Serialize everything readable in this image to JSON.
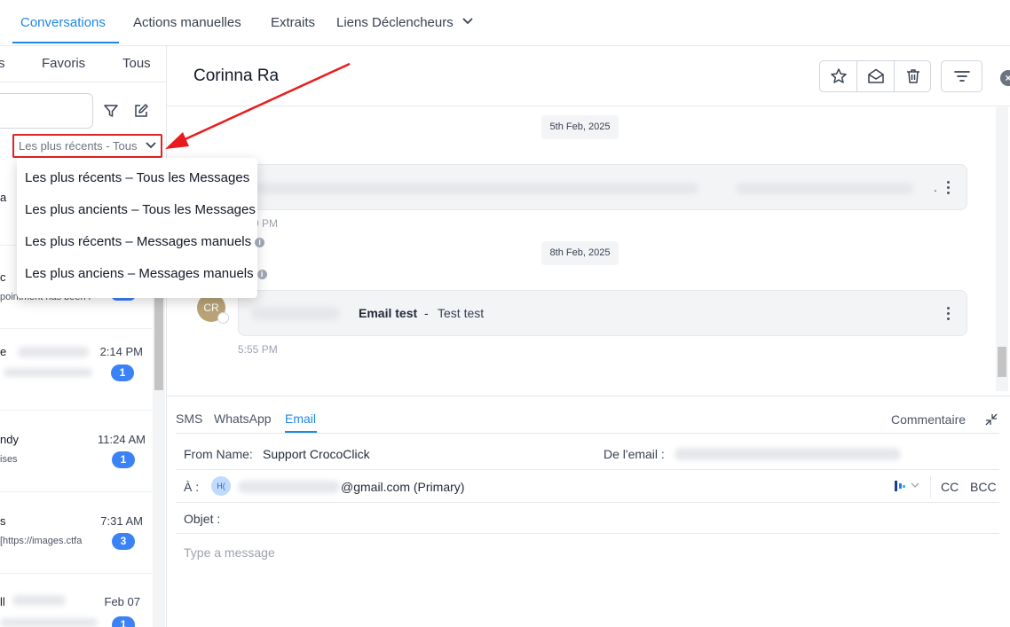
{
  "topnav": {
    "tabs": [
      "Conversations",
      "Actions manuelles",
      "Extraits",
      "Liens Déclencheurs"
    ],
    "active": "Conversations"
  },
  "left": {
    "subtabs": [
      "s",
      "Favoris",
      "Tous"
    ],
    "sort_label": "Les plus récents - Tous",
    "conversations": [
      {
        "name": "a",
        "time": "",
        "preview": "",
        "badge": ""
      },
      {
        "name": "c",
        "time": "",
        "preview": "pointment has been r",
        "badge": ""
      },
      {
        "name": "e",
        "time": "2:14 PM",
        "preview": "",
        "badge": "1"
      },
      {
        "name": "ndy",
        "time": "11:24 AM",
        "preview": "ises",
        "badge": "1"
      },
      {
        "name": "s",
        "time": "7:31 AM",
        "preview": "[https://images.ctfa",
        "badge": "3"
      },
      {
        "name": "ll",
        "time": "Feb 07",
        "preview": "",
        "badge": "1"
      }
    ]
  },
  "dropdown": {
    "items": [
      {
        "label": "Les plus récents – Tous les Messages",
        "info": false
      },
      {
        "label": "Les plus ancients – Tous les Messages",
        "info": false
      },
      {
        "label": "Les plus récents – Messages manuels",
        "info": true
      },
      {
        "label": "Les plus anciens – Messages manuels",
        "info": true
      }
    ]
  },
  "header": {
    "contact_name": "Corinna Ra",
    "close_glyph": "×"
  },
  "thread": {
    "messages": [
      {
        "date": "5th Feb, 2025",
        "time": "9 PM",
        "text_end": "."
      },
      {
        "date": "8th Feb, 2025",
        "time": "5:55 PM",
        "subject": "Email test",
        "separator": "-",
        "body": "Test test",
        "avatar": "CR"
      }
    ]
  },
  "composer": {
    "tabs": [
      "SMS",
      "WhatsApp",
      "Email"
    ],
    "active_tab": "Email",
    "comment_label": "Commentaire",
    "from_name_label": "From Name:",
    "from_name_value": "Support CrocoClick",
    "from_email_label": "De l'email :",
    "to_label": "À :",
    "to_avatar": "H(",
    "to_value": "@gmail.com (Primary)",
    "cc_label": "CC",
    "bcc_label": "BCC",
    "subject_label": "Objet :",
    "message_placeholder": "Type a message"
  },
  "icons": {
    "star": "star-icon",
    "envelope": "envelope-open-icon",
    "trash": "trash-icon",
    "filter": "filter-lines-icon",
    "close": "close-icon",
    "funnel": "funnel-icon",
    "compose": "compose-icon",
    "collapse": "collapse-icon"
  },
  "colors": {
    "accent": "#1e88e5",
    "badge": "#3b82f6",
    "highlight": "#e02424"
  }
}
